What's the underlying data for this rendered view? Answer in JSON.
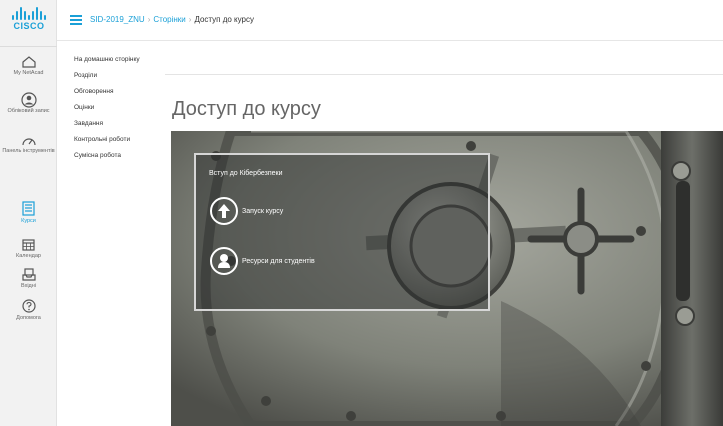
{
  "brand": {
    "logo_text": "CISCO",
    "accent_color": "#1ba0d7"
  },
  "rail": {
    "items": [
      {
        "label": "My NetAcad",
        "icon": "home-icon"
      },
      {
        "label": "Обліковий запис",
        "icon": "account-icon"
      },
      {
        "label": "Панель інструментів",
        "icon": "dashboard-icon"
      },
      {
        "label": "Курси",
        "icon": "courses-icon",
        "active": true
      },
      {
        "label": "Календар",
        "icon": "calendar-icon"
      },
      {
        "label": "Вхідні",
        "icon": "inbox-icon"
      },
      {
        "label": "Допомога",
        "icon": "help-icon"
      }
    ]
  },
  "breadcrumb": {
    "course": "SID-2019_ZNU",
    "pages": "Сторінки",
    "current": "Доступ до курсу",
    "separator": "›"
  },
  "course_nav": {
    "items": [
      "На домашню сторінку",
      "Розділи",
      "Обговорення",
      "Оцінки",
      "Завдання",
      "Контрольні роботи",
      "Сумісна робота"
    ]
  },
  "page": {
    "title": "Доступ до курсу"
  },
  "overlay": {
    "heading": "Вступ до Кібербезпеки",
    "launch_label": "Запуск курсу",
    "launch_icon": "arrow-up-circle-icon",
    "resources_label": "Ресурси для студентів",
    "resources_icon": "person-circle-icon"
  }
}
